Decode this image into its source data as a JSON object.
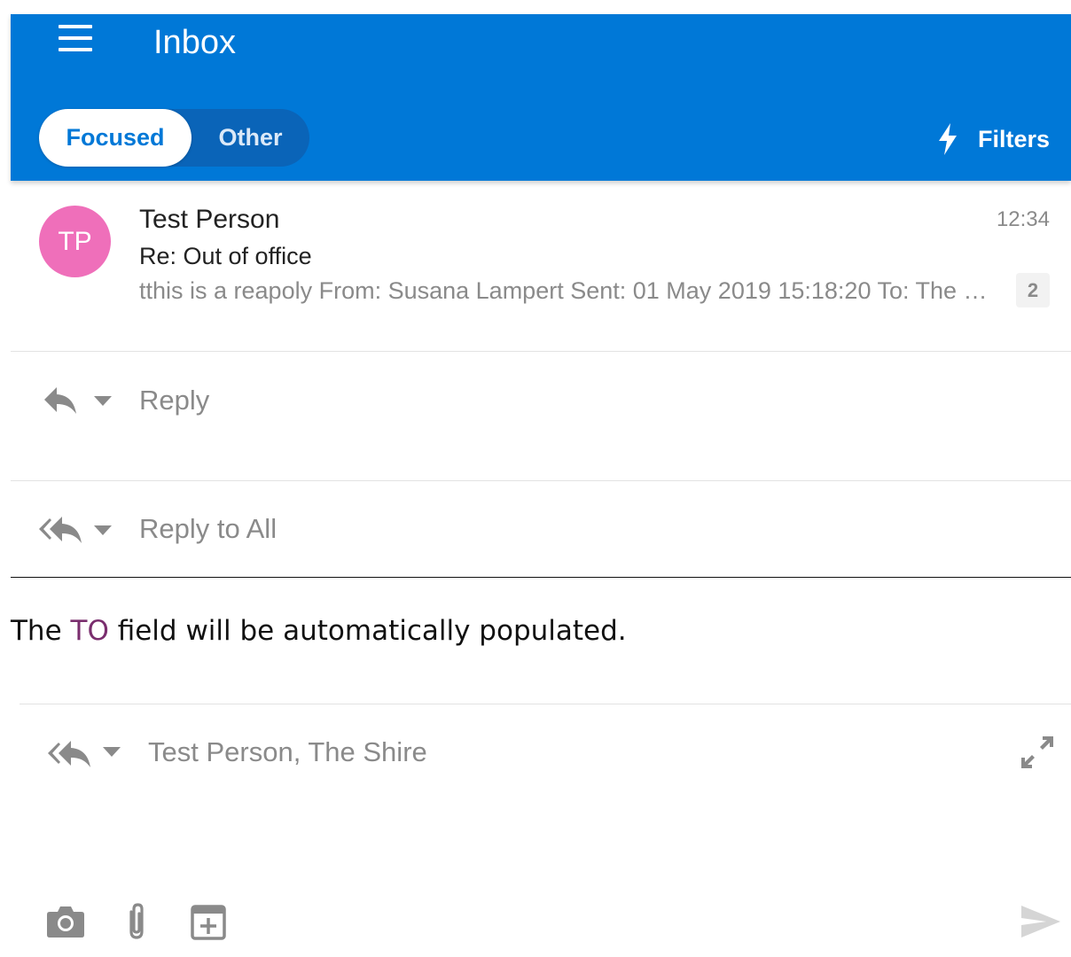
{
  "header": {
    "title": "Inbox",
    "tabs": [
      {
        "label": "Focused",
        "selected": true
      },
      {
        "label": "Other",
        "selected": false
      }
    ],
    "filters_label": "Filters",
    "background_color": "#0078d7"
  },
  "message": {
    "avatar_initials": "TP",
    "avatar_color": "#ef6fba",
    "sender": "Test Person",
    "time": "12:34",
    "subject": "Re: Out of office",
    "preview": "tthis is a reapoly From: Susana Lampert Sent: 01 May 2019 15:18:20 To: The Shire Subject: Out of office",
    "thread_count": "2"
  },
  "actions": {
    "reply_label": "Reply",
    "reply_all_label": "Reply to All"
  },
  "instruction": {
    "prefix": "The ",
    "highlight": "TO",
    "suffix": " field will be automatically populated."
  },
  "compose": {
    "recipients": "Test Person, The Shire"
  }
}
